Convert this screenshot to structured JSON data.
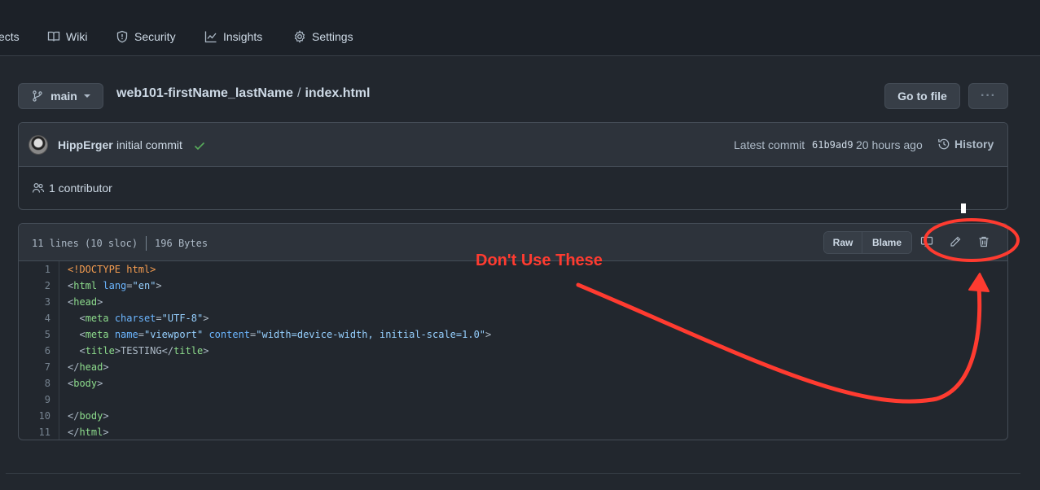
{
  "nav": {
    "items": [
      {
        "label": "ects",
        "icon": "project-icon"
      },
      {
        "label": "Wiki",
        "icon": "book-icon"
      },
      {
        "label": "Security",
        "icon": "shield-icon"
      },
      {
        "label": "Insights",
        "icon": "graph-icon"
      },
      {
        "label": "Settings",
        "icon": "gear-icon"
      }
    ]
  },
  "repo": {
    "branch": "main",
    "name": "web101-firstName_lastName",
    "separator": "/",
    "file": "index.html",
    "goto_file_label": "Go to file",
    "more_label": "···"
  },
  "commit": {
    "author": "HippErger",
    "message": "initial commit",
    "latest_label": "Latest commit",
    "sha": "61b9ad9",
    "time": "20 hours ago",
    "history_label": "History",
    "contributors": "1 contributor"
  },
  "file": {
    "lines_info": "11 lines (10 sloc)",
    "size": "196 Bytes",
    "raw_label": "Raw",
    "blame_label": "Blame"
  },
  "code": {
    "line_numbers": [
      "1",
      "2",
      "3",
      "4",
      "5",
      "6",
      "7",
      "8",
      "9",
      "10",
      "11"
    ]
  },
  "annotation": {
    "text": "Don't Use These",
    "color": "#ff3b30"
  },
  "colors": {
    "background": "#22272e",
    "header": "#1c2128",
    "success": "#57ab5a"
  }
}
